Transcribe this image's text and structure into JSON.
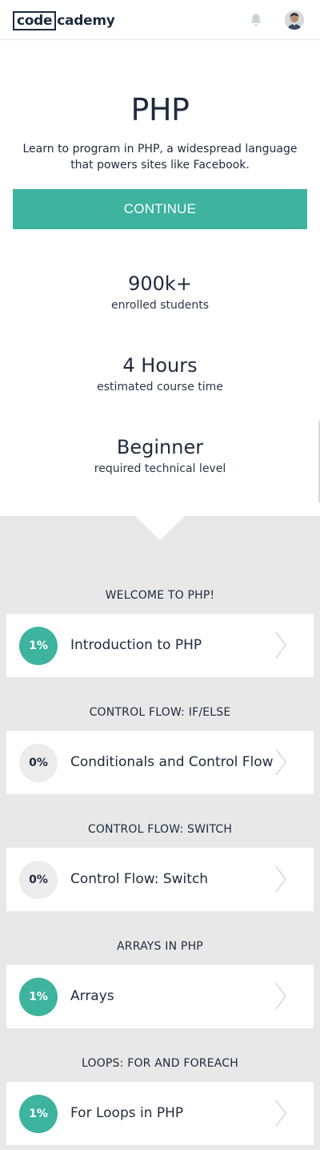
{
  "header": {
    "logo_box": "code",
    "logo_rest": "cademy",
    "bell_icon": "bell-icon",
    "avatar_icon": "user-avatar"
  },
  "hero": {
    "title": "PHP",
    "description": "Learn to program in PHP, a widespread language that powers sites like Facebook.",
    "continue_label": "CONTINUE"
  },
  "stats": [
    {
      "value": "900k+",
      "label": "enrolled students"
    },
    {
      "value": "4 Hours",
      "label": "estimated course time"
    },
    {
      "value": "Beginner",
      "label": "required technical level"
    }
  ],
  "sections": [
    {
      "title": "WELCOME TO PHP!",
      "lesson": "Introduction to PHP",
      "progress": "1%",
      "started": true
    },
    {
      "title": "CONTROL FLOW: IF/ELSE",
      "lesson": "Conditionals and Control Flow",
      "progress": "0%",
      "started": false
    },
    {
      "title": "CONTROL FLOW: SWITCH",
      "lesson": "Control Flow: Switch",
      "progress": "0%",
      "started": false
    },
    {
      "title": "ARRAYS IN PHP",
      "lesson": "Arrays",
      "progress": "1%",
      "started": true
    },
    {
      "title": "LOOPS: FOR AND FOREACH",
      "lesson": "For Loops in PHP",
      "progress": "1%",
      "started": true
    }
  ],
  "colors": {
    "accent": "#3eb39e",
    "text": "#1f2b3d",
    "section_bg": "#e8e8e8",
    "chevron": "#d8d8d8"
  }
}
